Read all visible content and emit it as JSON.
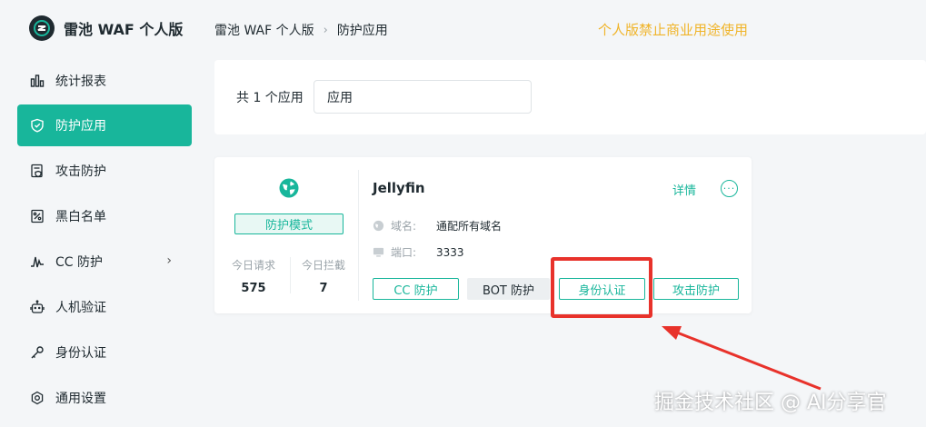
{
  "brand": {
    "title": "雷池 WAF 个人版"
  },
  "sidebar": {
    "items": [
      {
        "label": "统计报表",
        "icon": "bar-chart-icon"
      },
      {
        "label": "防护应用",
        "icon": "shield-icon",
        "active": true
      },
      {
        "label": "攻击防护",
        "icon": "document-shield-icon"
      },
      {
        "label": "黑白名单",
        "icon": "list-check-icon"
      },
      {
        "label": "CC 防护",
        "icon": "pulse-icon",
        "has_submenu": true
      },
      {
        "label": "人机验证",
        "icon": "robot-icon"
      },
      {
        "label": "身份认证",
        "icon": "key-icon"
      },
      {
        "label": "通用设置",
        "icon": "gear-icon"
      }
    ]
  },
  "header": {
    "breadcrumb": [
      "雷池 WAF 个人版",
      "防护应用"
    ],
    "notice": "个人版禁止商业用途使用"
  },
  "filter": {
    "count_text": "共 1 个应用",
    "search_value": "应用"
  },
  "app_card": {
    "mode_badge": "防护模式",
    "stats": [
      {
        "label": "今日请求",
        "value": "575"
      },
      {
        "label": "今日拦截",
        "value": "7"
      }
    ],
    "name": "Jellyfin",
    "detail_link": "详情",
    "domain_label": "域名:",
    "domain_value": "通配所有域名",
    "port_label": "端口:",
    "port_value": "3333",
    "tags": [
      {
        "label": "CC 防护",
        "enabled": true
      },
      {
        "label": "BOT 防护",
        "enabled": false
      },
      {
        "label": "身份认证",
        "enabled": true
      },
      {
        "label": "攻击防护",
        "enabled": true
      }
    ]
  },
  "colors": {
    "accent": "#18b69b",
    "notice": "#f0b429",
    "annotation": "#e8322b",
    "background": "#f4f6f8"
  },
  "watermark": "掘金技术社区 @ AI分享官"
}
